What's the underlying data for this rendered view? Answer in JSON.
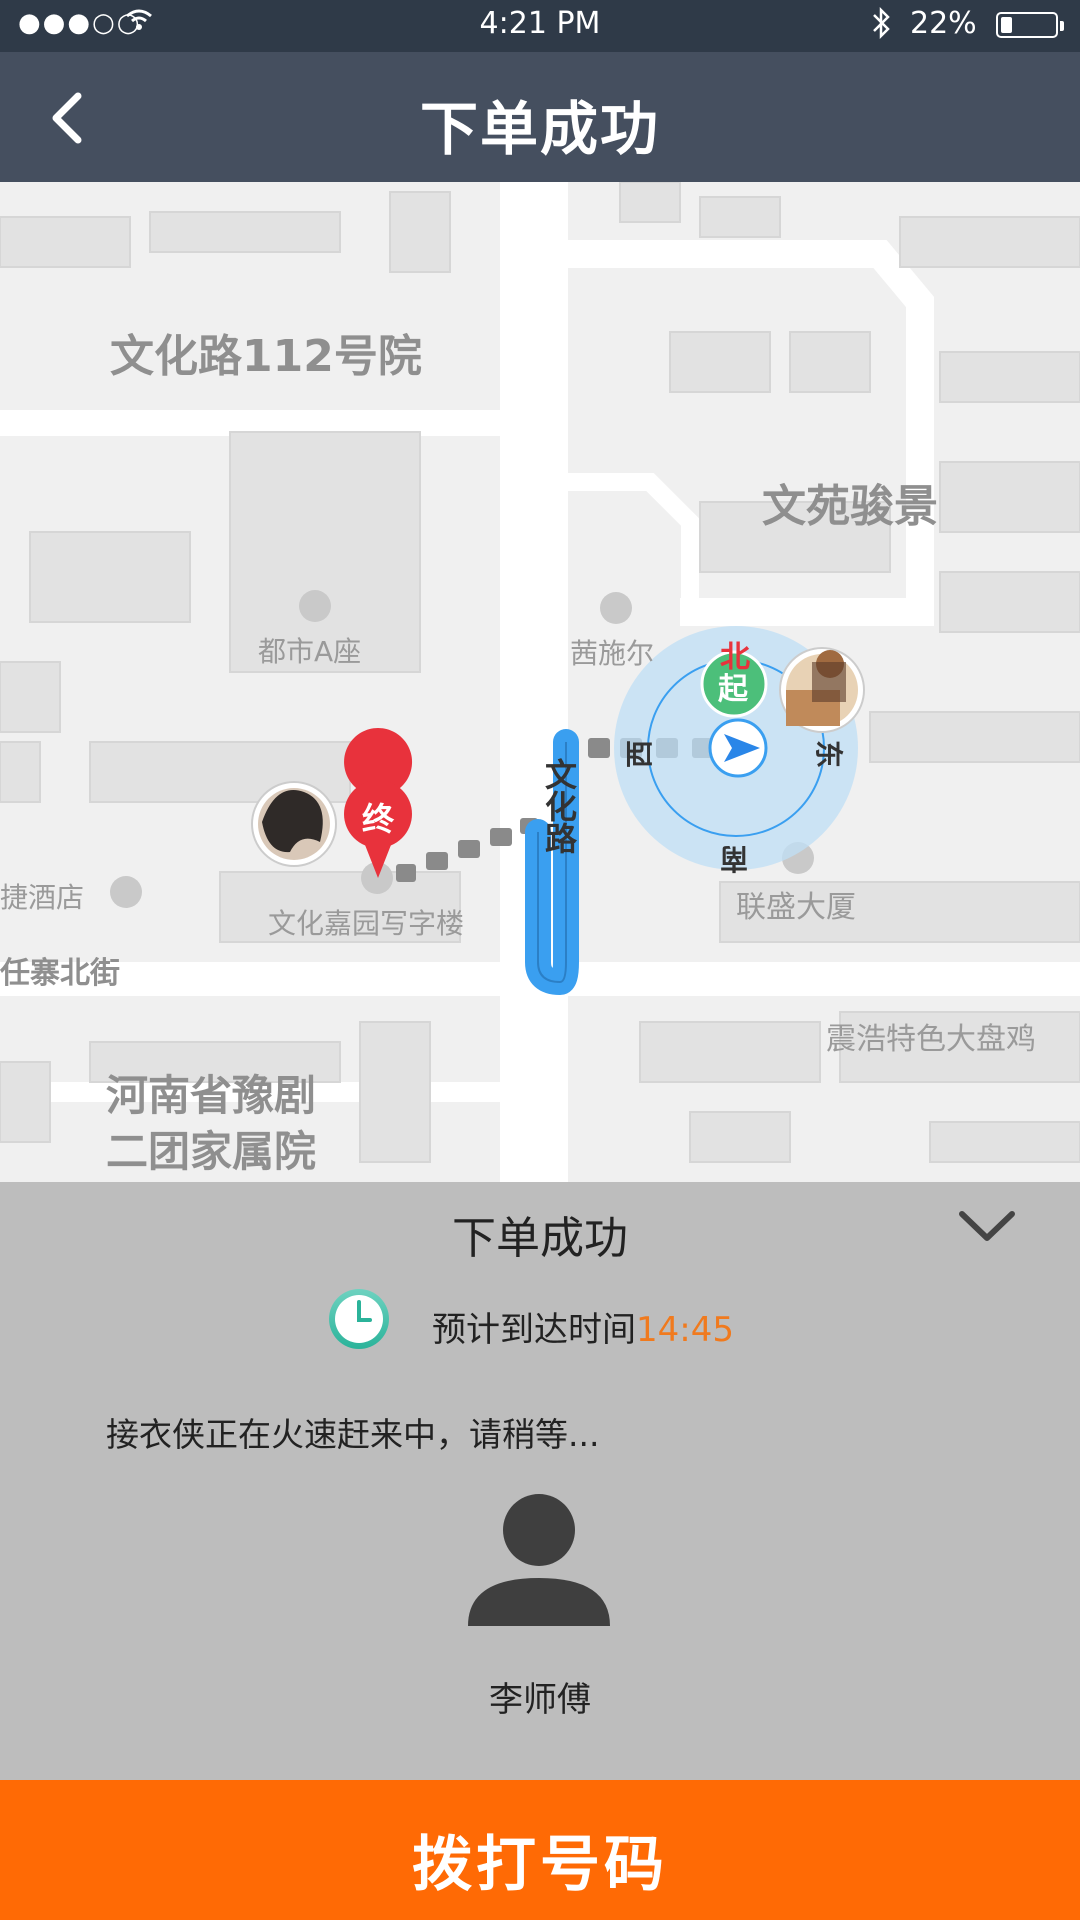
{
  "status_bar": {
    "signal": "●●●○○",
    "time": "4:21 PM",
    "battery": "22%",
    "battery_level": 0.22
  },
  "nav": {
    "title": "下单成功",
    "back_icon": "chevron-left-icon"
  },
  "map": {
    "labels": {
      "wenhualu112": "文化路112号院",
      "wenyuan": "文苑骏景",
      "dushi": "都市A座",
      "qianshier": "茜施尔",
      "wenhualu_road": "文化路",
      "jiejiudian": "捷酒店",
      "wenhuajiayuan": "文化嘉园写字楼",
      "lianshengdasha": "联盛大厦",
      "zhaibeijie": "任寨北街",
      "zhenhao": "震浩特色大盘鸡",
      "henan_line1": "河南省豫剧",
      "henan_line2": "二团家属院"
    },
    "compass": {
      "north": "北",
      "south": "南",
      "east": "东",
      "west": "西"
    },
    "start_badge": "起",
    "end_badge": "终",
    "colors": {
      "route": "#3a9ff0",
      "start": "#4cbf7a",
      "end": "#e8323c"
    }
  },
  "panel": {
    "title": "下单成功",
    "collapse_icon": "chevron-down-icon",
    "eta_label": "预计到达时间",
    "eta_time": "14:45",
    "status_text": "接衣侠正在火速赶来中，请稍等...",
    "driver_name": "李师傅",
    "accent": "#f07a1e"
  },
  "call_button": {
    "label": "拨打号码",
    "color": "#ff6a05"
  }
}
